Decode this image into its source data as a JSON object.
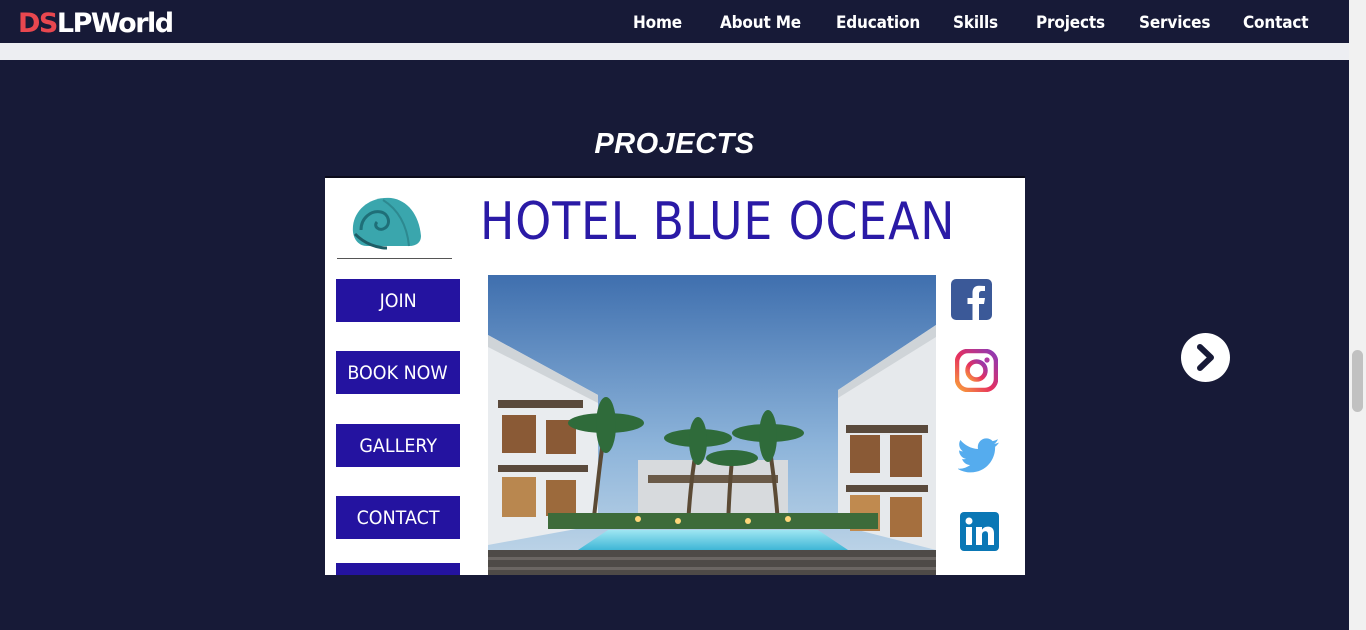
{
  "brand": {
    "part1": "DS",
    "part2": "LPWorld"
  },
  "nav": {
    "home": "Home",
    "about": "About Me",
    "education": "Education",
    "skills": "Skills",
    "projects": "Projects",
    "services": "Services",
    "contact": "Contact"
  },
  "section": {
    "title": "PROJECTS"
  },
  "slide": {
    "title": "HOTEL BLUE OCEAN",
    "buttons": {
      "join": "JOIN",
      "book": "BOOK NOW",
      "gallery": "GALLERY",
      "contact": "CONTACT"
    },
    "social_icons": [
      "facebook-icon",
      "instagram-icon",
      "twitter-icon",
      "linkedin-icon"
    ]
  },
  "carousel": {
    "next_icon": "chevron-right-icon"
  },
  "colors": {
    "background": "#171a37",
    "brand_red": "#e8474f",
    "mock_blue": "#2413a0"
  }
}
